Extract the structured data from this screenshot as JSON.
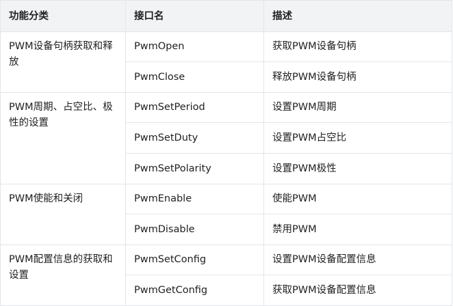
{
  "table": {
    "headers": [
      "功能分类",
      "接口名",
      "描述"
    ],
    "groups": [
      {
        "category": "PWM设备句柄获取和释放",
        "rows": [
          {
            "api": "PwmOpen",
            "desc": "获取PWM设备句柄"
          },
          {
            "api": "PwmClose",
            "desc": "释放PWM设备句柄"
          }
        ]
      },
      {
        "category": "PWM周期、占空比、极性的设置",
        "rows": [
          {
            "api": "PwmSetPeriod",
            "desc": "设置PWM周期"
          },
          {
            "api": "PwmSetDuty",
            "desc": "设置PWM占空比"
          },
          {
            "api": "PwmSetPolarity",
            "desc": "设置PWM极性"
          }
        ]
      },
      {
        "category": "PWM使能和关闭",
        "rows": [
          {
            "api": "PwmEnable",
            "desc": "使能PWM"
          },
          {
            "api": "PwmDisable",
            "desc": "禁用PWM"
          }
        ]
      },
      {
        "category": "PWM配置信息的获取和设置",
        "rows": [
          {
            "api": "PwmSetConfig",
            "desc": "设置PWM设备配置信息"
          },
          {
            "api": "PwmGetConfig",
            "desc": "获取PWM设备配置信息"
          }
        ]
      }
    ]
  }
}
